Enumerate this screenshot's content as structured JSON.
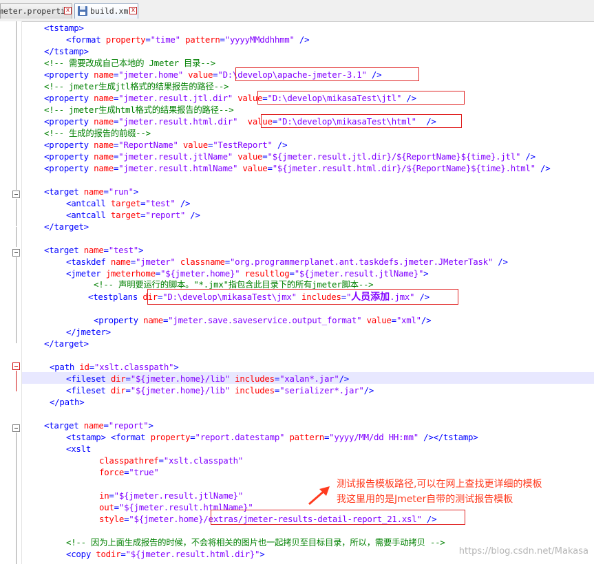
{
  "tabs": [
    {
      "label": "meter.properties",
      "active": false
    },
    {
      "label": "build.xml",
      "active": true
    }
  ],
  "icons": {
    "save": "save-disk-icon",
    "close": "close-icon",
    "arrow": "red-arrow-icon"
  },
  "colors": {
    "tag": "#0000ff",
    "attribute": "#ff0000",
    "value": "#8000ff",
    "comment": "#008000",
    "highlight_box": "#e02020",
    "annotation": "#ff3b1f"
  },
  "code": {
    "l01": "<tstamp>",
    "l02a": "<format ",
    "l02b": "property",
    "l02c": "=",
    "l02d": "\"time\"",
    "l02e": " pattern",
    "l02f": "=",
    "l02g": "\"yyyyMMddhhmm\"",
    "l02h": " />",
    "l03": "</tstamp>",
    "l04": "<!-- 需要改成自己本地的 Jmeter 目录-->",
    "l05a": "<property ",
    "l05b": "name",
    "l05c": "=",
    "l05d": "\"jmeter.home\"",
    "l05e": " value",
    "l05f": "=",
    "l05g": "\"D:\\develop\\apache-jmeter-3.1\"",
    "l05h": " />",
    "l06": "<!-- jmeter生成jtl格式的结果报告的路径-->",
    "l07a": "<property ",
    "l07b": "name",
    "l07c": "=",
    "l07d": "\"jmeter.result.jtl.dir\"",
    "l07e": " value",
    "l07f": "=",
    "l07g": "\"D:\\develop\\mikasaTest\\jtl\"",
    "l07h": " />",
    "l08": "<!-- jmeter生成html格式的结果报告的路径-->",
    "l09a": "<property ",
    "l09b": "name",
    "l09c": "=",
    "l09d": "\"jmeter.result.html.dir\"",
    "l09e": "  value",
    "l09f": "=",
    "l09g": "\"D:\\develop\\mikasaTest\\html\"",
    "l09h": "  />",
    "l10": "<!-- 生成的报告的前缀-->",
    "l11a": "<property ",
    "l11b": "name",
    "l11c": "=",
    "l11d": "\"ReportName\"",
    "l11e": " value",
    "l11f": "=",
    "l11g": "\"TestReport\"",
    "l11h": " />",
    "l12a": "<property ",
    "l12b": "name",
    "l12c": "=",
    "l12d": "\"jmeter.result.jtlName\"",
    "l12e": " value",
    "l12f": "=",
    "l12g": "\"${jmeter.result.jtl.dir}/${ReportName}${time}.jtl\"",
    "l12h": " />",
    "l13a": "<property ",
    "l13b": "name",
    "l13c": "=",
    "l13d": "\"jmeter.result.htmlName\"",
    "l13e": " value",
    "l13f": "=",
    "l13g": "\"${jmeter.result.html.dir}/${ReportName}${time}.html\"",
    "l13h": " />",
    "l15a": "<target ",
    "l15b": "name",
    "l15c": "=",
    "l15d": "\"run\"",
    "l15e": ">",
    "l16a": "<antcall ",
    "l16b": "target",
    "l16c": "=",
    "l16d": "\"test\"",
    "l16e": " />",
    "l17a": "<antcall ",
    "l17b": "target",
    "l17c": "=",
    "l17d": "\"report\"",
    "l17e": " />",
    "l18": "</target>",
    "l20a": "<target ",
    "l20b": "name",
    "l20c": "=",
    "l20d": "\"test\"",
    "l20e": ">",
    "l21a": "<taskdef ",
    "l21b": "name",
    "l21c": "=",
    "l21d": "\"jmeter\"",
    "l21e": " classname",
    "l21f": "=",
    "l21g": "\"org.programmerplanet.ant.taskdefs.jmeter.JMeterTask\"",
    "l21h": " />",
    "l22a": "<jmeter ",
    "l22b": "jmeterhome",
    "l22c": "=",
    "l22d": "\"${jmeter.home}\"",
    "l22e": " resultlog",
    "l22f": "=",
    "l22g": "\"${jmeter.result.jtlName}\"",
    "l22h": ">",
    "l23": "<!-- 声明要运行的脚本。\"*.jmx\"指包含此目录下的所有jmeter脚本-->",
    "l24a": "<testplans ",
    "l24b": "dir",
    "l24c": "=",
    "l24d": "\"D:\\develop\\mikasaTest\\jmx\"",
    "l24e": " includes",
    "l24f": "=",
    "l24g": "\"",
    "l24h": "人员添加",
    "l24i": ".jmx\"",
    "l24j": " />",
    "l26a": "<property ",
    "l26b": "name",
    "l26c": "=",
    "l26d": "\"jmeter.save.saveservice.output_format\"",
    "l26e": " value",
    "l26f": "=",
    "l26g": "\"xml\"",
    "l26h": "/>",
    "l27": "</jmeter>",
    "l28": "</target>",
    "l30a": "<path ",
    "l30b": "id",
    "l30c": "=",
    "l30d": "\"xslt.classpath\"",
    "l30e": ">",
    "l31a": "<fileset ",
    "l31b": "dir",
    "l31c": "=",
    "l31d": "\"${jmeter.home}/lib\"",
    "l31e": " includes",
    "l31f": "=",
    "l31g": "\"xalan*.jar\"",
    "l31h": "/>",
    "l32a": "<fileset ",
    "l32b": "dir",
    "l32c": "=",
    "l32d": "\"${jmeter.home}/lib\"",
    "l32e": " includes",
    "l32f": "=",
    "l32g": "\"serializer*.jar\"",
    "l32h": "/>",
    "l33": "</path>",
    "l35a": "<target ",
    "l35b": "name",
    "l35c": "=",
    "l35d": "\"report\"",
    "l35e": ">",
    "l36a": "<tstamp>",
    "l36b": " <format ",
    "l36c": "property",
    "l36d": "=",
    "l36e": "\"report.datestamp\"",
    "l36f": " pattern",
    "l36g": "=",
    "l36h": "\"yyyy/MM/dd HH:mm\"",
    "l36i": " /></tstamp>",
    "l37": "<xslt",
    "l38a": "classpathref",
    "l38b": "=",
    "l38c": "\"xslt.classpath\"",
    "l39a": "force",
    "l39b": "=",
    "l39c": "\"true\"",
    "l41a": "in",
    "l41b": "=",
    "l41c": "\"${jmeter.result.jtlName}\"",
    "l42a": "out",
    "l42b": "=",
    "l42c": "\"${jmeter.result.htmlName}\"",
    "l43a": "style",
    "l43b": "=",
    "l43c": "\"${jmeter.home}/extras/jmeter-results-detail-report_21.xsl\"",
    "l43d": " />",
    "l45": "<!-- 因为上面生成报告的时候，不会将相关的图片也一起拷贝至目标目录，所以，需要手动拷贝 -->",
    "l46a": "<copy ",
    "l46b": "todir",
    "l46c": "=",
    "l46d": "\"${jmeter.result.html.dir}\"",
    "l46e": ">"
  },
  "annotation": {
    "line1": "测试报告模板路径,可以在网上查找更详细的模板",
    "line2": "我这里用的是Jmeter自带的测试报告模板"
  },
  "watermark": "https://blog.csdn.net/Makasa"
}
